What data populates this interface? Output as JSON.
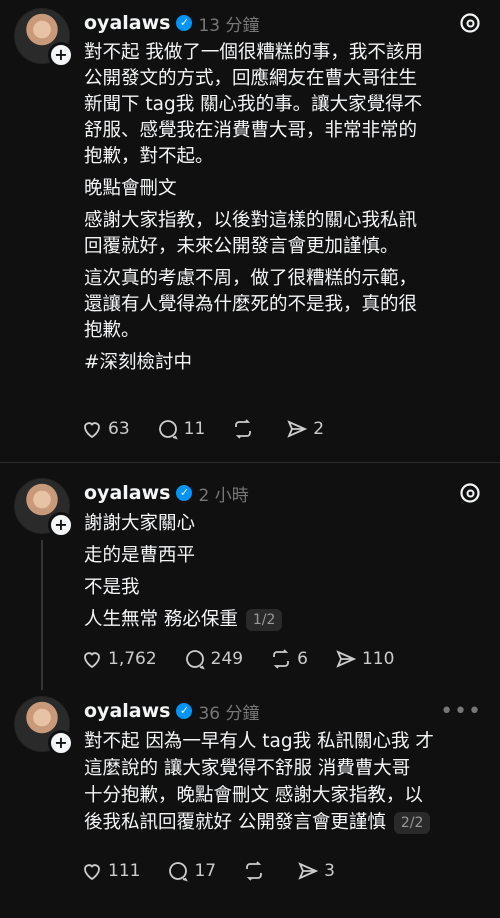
{
  "posts": [
    {
      "username": "oyalaws",
      "time": "13 分鐘",
      "paragraphs": [
        "對不起 我做了一個很糟糕的事，我不該用\n公開發文的方式，回應網友在曹大哥往生\n新聞下 tag我 關心我的事。讓大家覺得不\n舒服、感覺我在消費曹大哥，非常非常的\n抱歉，對不起。",
        "晚點會刪文",
        "感謝大家指教，以後對這樣的關心我私訊\n回覆就好，未來公開發言會更加謹慎。",
        "這次真的考慮不周，做了很糟糕的示範，\n還讓有人覺得為什麼死的不是我，真的很\n抱歉。",
        "#深刻檢討中"
      ],
      "likes": "63",
      "replies": "11",
      "reposts": "",
      "shares": "2"
    },
    {
      "username": "oyalaws",
      "time": "2 小時",
      "paragraphs": [
        "謝謝大家關心",
        "走的是曹西平",
        "不是我",
        "人生無常 務必保重"
      ],
      "badge": "1/2",
      "likes": "1,762",
      "replies": "249",
      "reposts": "6",
      "shares": "110"
    },
    {
      "username": "oyalaws",
      "time": "36 分鐘",
      "paragraphs": [
        "對不起 因為一早有人 tag我 私訊關心我 才\n這麼說的 讓大家覺得不舒服 消費曹大哥\n十分抱歉，晚點會刪文 感謝大家指教，以\n後我私訊回覆就好 公開發言會更謹慎"
      ],
      "badge": "2/2",
      "likes": "111",
      "replies": "17",
      "reposts": "",
      "shares": "3"
    }
  ]
}
